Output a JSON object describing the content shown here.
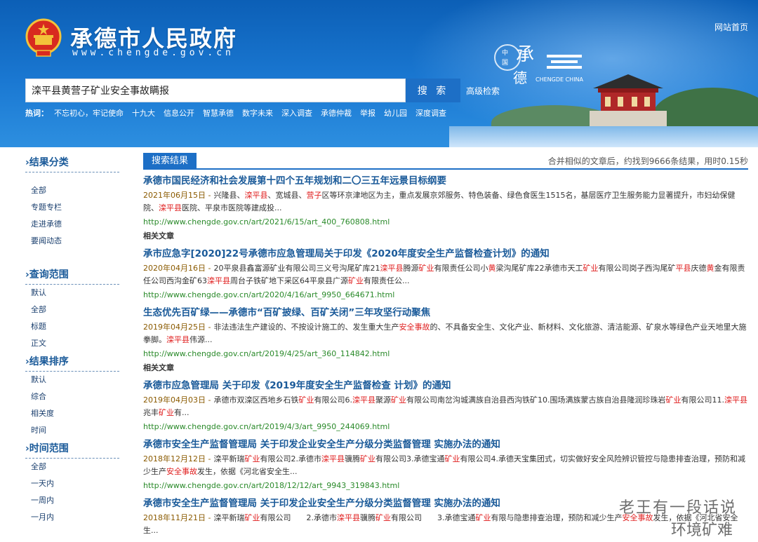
{
  "header": {
    "site_title": "承德市人民政府",
    "site_url": "www.chengde.gov.cn",
    "home_link": "网站首页",
    "logo_text": "中国承德",
    "logo_sub": "CHENGDE CHINA"
  },
  "search": {
    "query": "滦平县黄营子矿业安全事故瞒报",
    "button": "搜 索",
    "advanced": "高级检索"
  },
  "hot": {
    "label": "热词：",
    "items": [
      "不忘初心，牢记使命",
      "十九大",
      "信息公开",
      "智慧承德",
      "数字未来",
      "深入调查",
      "承德仲裁",
      "举报",
      "幼儿园",
      "深度调查"
    ]
  },
  "sidebar": {
    "groups": [
      {
        "title": "›结果分类",
        "items": [
          "全部",
          "专题专栏",
          "走进承德",
          "要闻动态"
        ]
      },
      {
        "title": "›查询范围",
        "items": [
          "默认",
          "全部",
          "标题",
          "正文"
        ]
      },
      {
        "title": "›结果排序",
        "items": [
          "默认",
          "综合",
          "相关度",
          "时间"
        ]
      },
      {
        "title": "›时间范围",
        "items": [
          "全部",
          "一天内",
          "一周内",
          "一月内"
        ]
      }
    ]
  },
  "results_tab": "搜索结果",
  "stats": "合并相似的文章后，约找到9666条结果，用时0.15秒",
  "related_label": "相关文章",
  "results": [
    {
      "title": "承德市国民经济和社会发展第十四个五年规划和二〇三五年远景目标纲要",
      "date": "2021年06月15日 -",
      "snippet": [
        [
          "兴隆县、",
          ""
        ],
        [
          "滦平县",
          "hl"
        ],
        [
          "、宽城县、",
          ""
        ],
        [
          "营子",
          "hl"
        ],
        [
          "区等环京津地区为主，重点发展京郊服务、特色装备、绿色食医生1515名，基层医疗卫生服务能力显著提升，市妇幼保健院、",
          ""
        ],
        [
          "滦平县",
          "hl"
        ],
        [
          "医院、平泉市医院等建成投...",
          ""
        ]
      ],
      "url": "http://www.chengde.gov.cn/art/2021/6/15/art_400_760808.html",
      "related": true
    },
    {
      "title": "承市应急字[2020]22号承德市应急管理局关于印发《2020年度安全生产监督检查计划》的通知",
      "date": "2020年04月16日 -",
      "snippet": [
        [
          "20平泉县鑫富源矿业有限公司三义号沟尾矿库21",
          ""
        ],
        [
          "滦平县",
          "hl"
        ],
        [
          "腾源",
          ""
        ],
        [
          "矿业",
          "hl"
        ],
        [
          "有限责任公司小",
          ""
        ],
        [
          "黄",
          "hl"
        ],
        [
          "梁沟尾矿库22承德市天工",
          ""
        ],
        [
          "矿业",
          "hl"
        ],
        [
          "有限公司岗子西沟尾矿",
          ""
        ],
        [
          "平县",
          "hl"
        ],
        [
          "庆德",
          ""
        ],
        [
          "黄",
          "hl"
        ],
        [
          "金有限责任公司西沟金矿63",
          ""
        ],
        [
          "滦平县",
          "hl"
        ],
        [
          "周台子铁矿地下采区64平泉县广源",
          ""
        ],
        [
          "矿业",
          "hl"
        ],
        [
          "有限责任公...",
          ""
        ]
      ],
      "url": "http://www.chengde.gov.cn/art/2020/4/16/art_9950_664671.html",
      "related": false
    },
    {
      "title": "生态优先百矿绿——承德市“百矿披绿、百矿关闭”三年攻坚行动聚焦",
      "date": "2019年04月25日 -",
      "snippet": [
        [
          "非法违法生产建设的、不按设计施工的、发生重大生产",
          ""
        ],
        [
          "安全事故",
          "hl"
        ],
        [
          "的、不具备安全生、文化产业、新材料、文化旅游、清洁能源、矿泉水等绿色产业天地里大施拳脚。",
          ""
        ],
        [
          "滦平县",
          "hl"
        ],
        [
          "伟源...",
          ""
        ]
      ],
      "url": "http://www.chengde.gov.cn/art/2019/4/25/art_360_114842.html",
      "related": true
    },
    {
      "title": "承德市应急管理局 关于印发《2019年度安全生产监督检查 计划》的通知",
      "date": "2019年04月03日 -",
      "snippet": [
        [
          "承德市双滦区西地乡石铁",
          ""
        ],
        [
          "矿业",
          "hl"
        ],
        [
          "有限公司6.",
          ""
        ],
        [
          "滦平县",
          "hl"
        ],
        [
          "聚源",
          ""
        ],
        [
          "矿业",
          "hl"
        ],
        [
          "有限公司南岔沟城满族自治县西沟铁矿10.围场满族蒙古族自治县隆润珍珠岩",
          ""
        ],
        [
          "矿业",
          "hl"
        ],
        [
          "有限公司11.",
          ""
        ],
        [
          "滦平县",
          "hl"
        ],
        [
          "兆丰",
          ""
        ],
        [
          "矿业",
          "hl"
        ],
        [
          "有...",
          ""
        ]
      ],
      "url": "http://www.chengde.gov.cn/art/2019/4/3/art_9950_244069.html",
      "related": false
    },
    {
      "title": "承德市安全生产监督管理局 关于印发企业安全生产分级分类监督管理 实施办法的通知",
      "date": "2018年12月12日 -",
      "snippet": [
        [
          "滦平新瑞",
          ""
        ],
        [
          "矿业",
          "hl"
        ],
        [
          "有限公司2.承德市",
          ""
        ],
        [
          "滦平县",
          "hl"
        ],
        [
          "骥腾",
          ""
        ],
        [
          "矿业",
          "hl"
        ],
        [
          "有限公司3.承德宝通",
          ""
        ],
        [
          "矿业",
          "hl"
        ],
        [
          "有限公司4.承德天宝集团式，切实做好安全风险辨识管控与隐患排查治理，预防和减少生产",
          ""
        ],
        [
          "安全事故",
          "hl"
        ],
        [
          "发生，依据《河北省安全生...",
          ""
        ]
      ],
      "url": "http://www.chengde.gov.cn/art/2018/12/12/art_9943_319843.html",
      "related": false
    },
    {
      "title": "承德市安全生产监督管理局 关于印发企业安全生产分级分类监督管理 实施办法的通知",
      "date": "2018年11月21日 -",
      "snippet": [
        [
          "滦平新瑞",
          ""
        ],
        [
          "矿业",
          "hl"
        ],
        [
          "有限公司　　2.承德市",
          ""
        ],
        [
          "滦平县",
          "hl"
        ],
        [
          "骥腾",
          ""
        ],
        [
          "矿业",
          "hl"
        ],
        [
          "有限公司　　3.承德宝通",
          ""
        ],
        [
          "矿业",
          "hl"
        ],
        [
          "有限与隐患排查治理，预防和减少生产",
          ""
        ],
        [
          "安全事故",
          "hl"
        ],
        [
          "发生，依据《河北省安全生...",
          ""
        ]
      ],
      "url": "",
      "related": false
    }
  ],
  "watermark": {
    "line1": "老王有一段话说",
    "line2": "环境矿难"
  },
  "colors": {
    "header_blue": "#0c5fb6",
    "accent": "#1d6fc6",
    "title_link": "#1a5a99",
    "highlight": "#e02020",
    "url_green": "#2a8a2a"
  }
}
